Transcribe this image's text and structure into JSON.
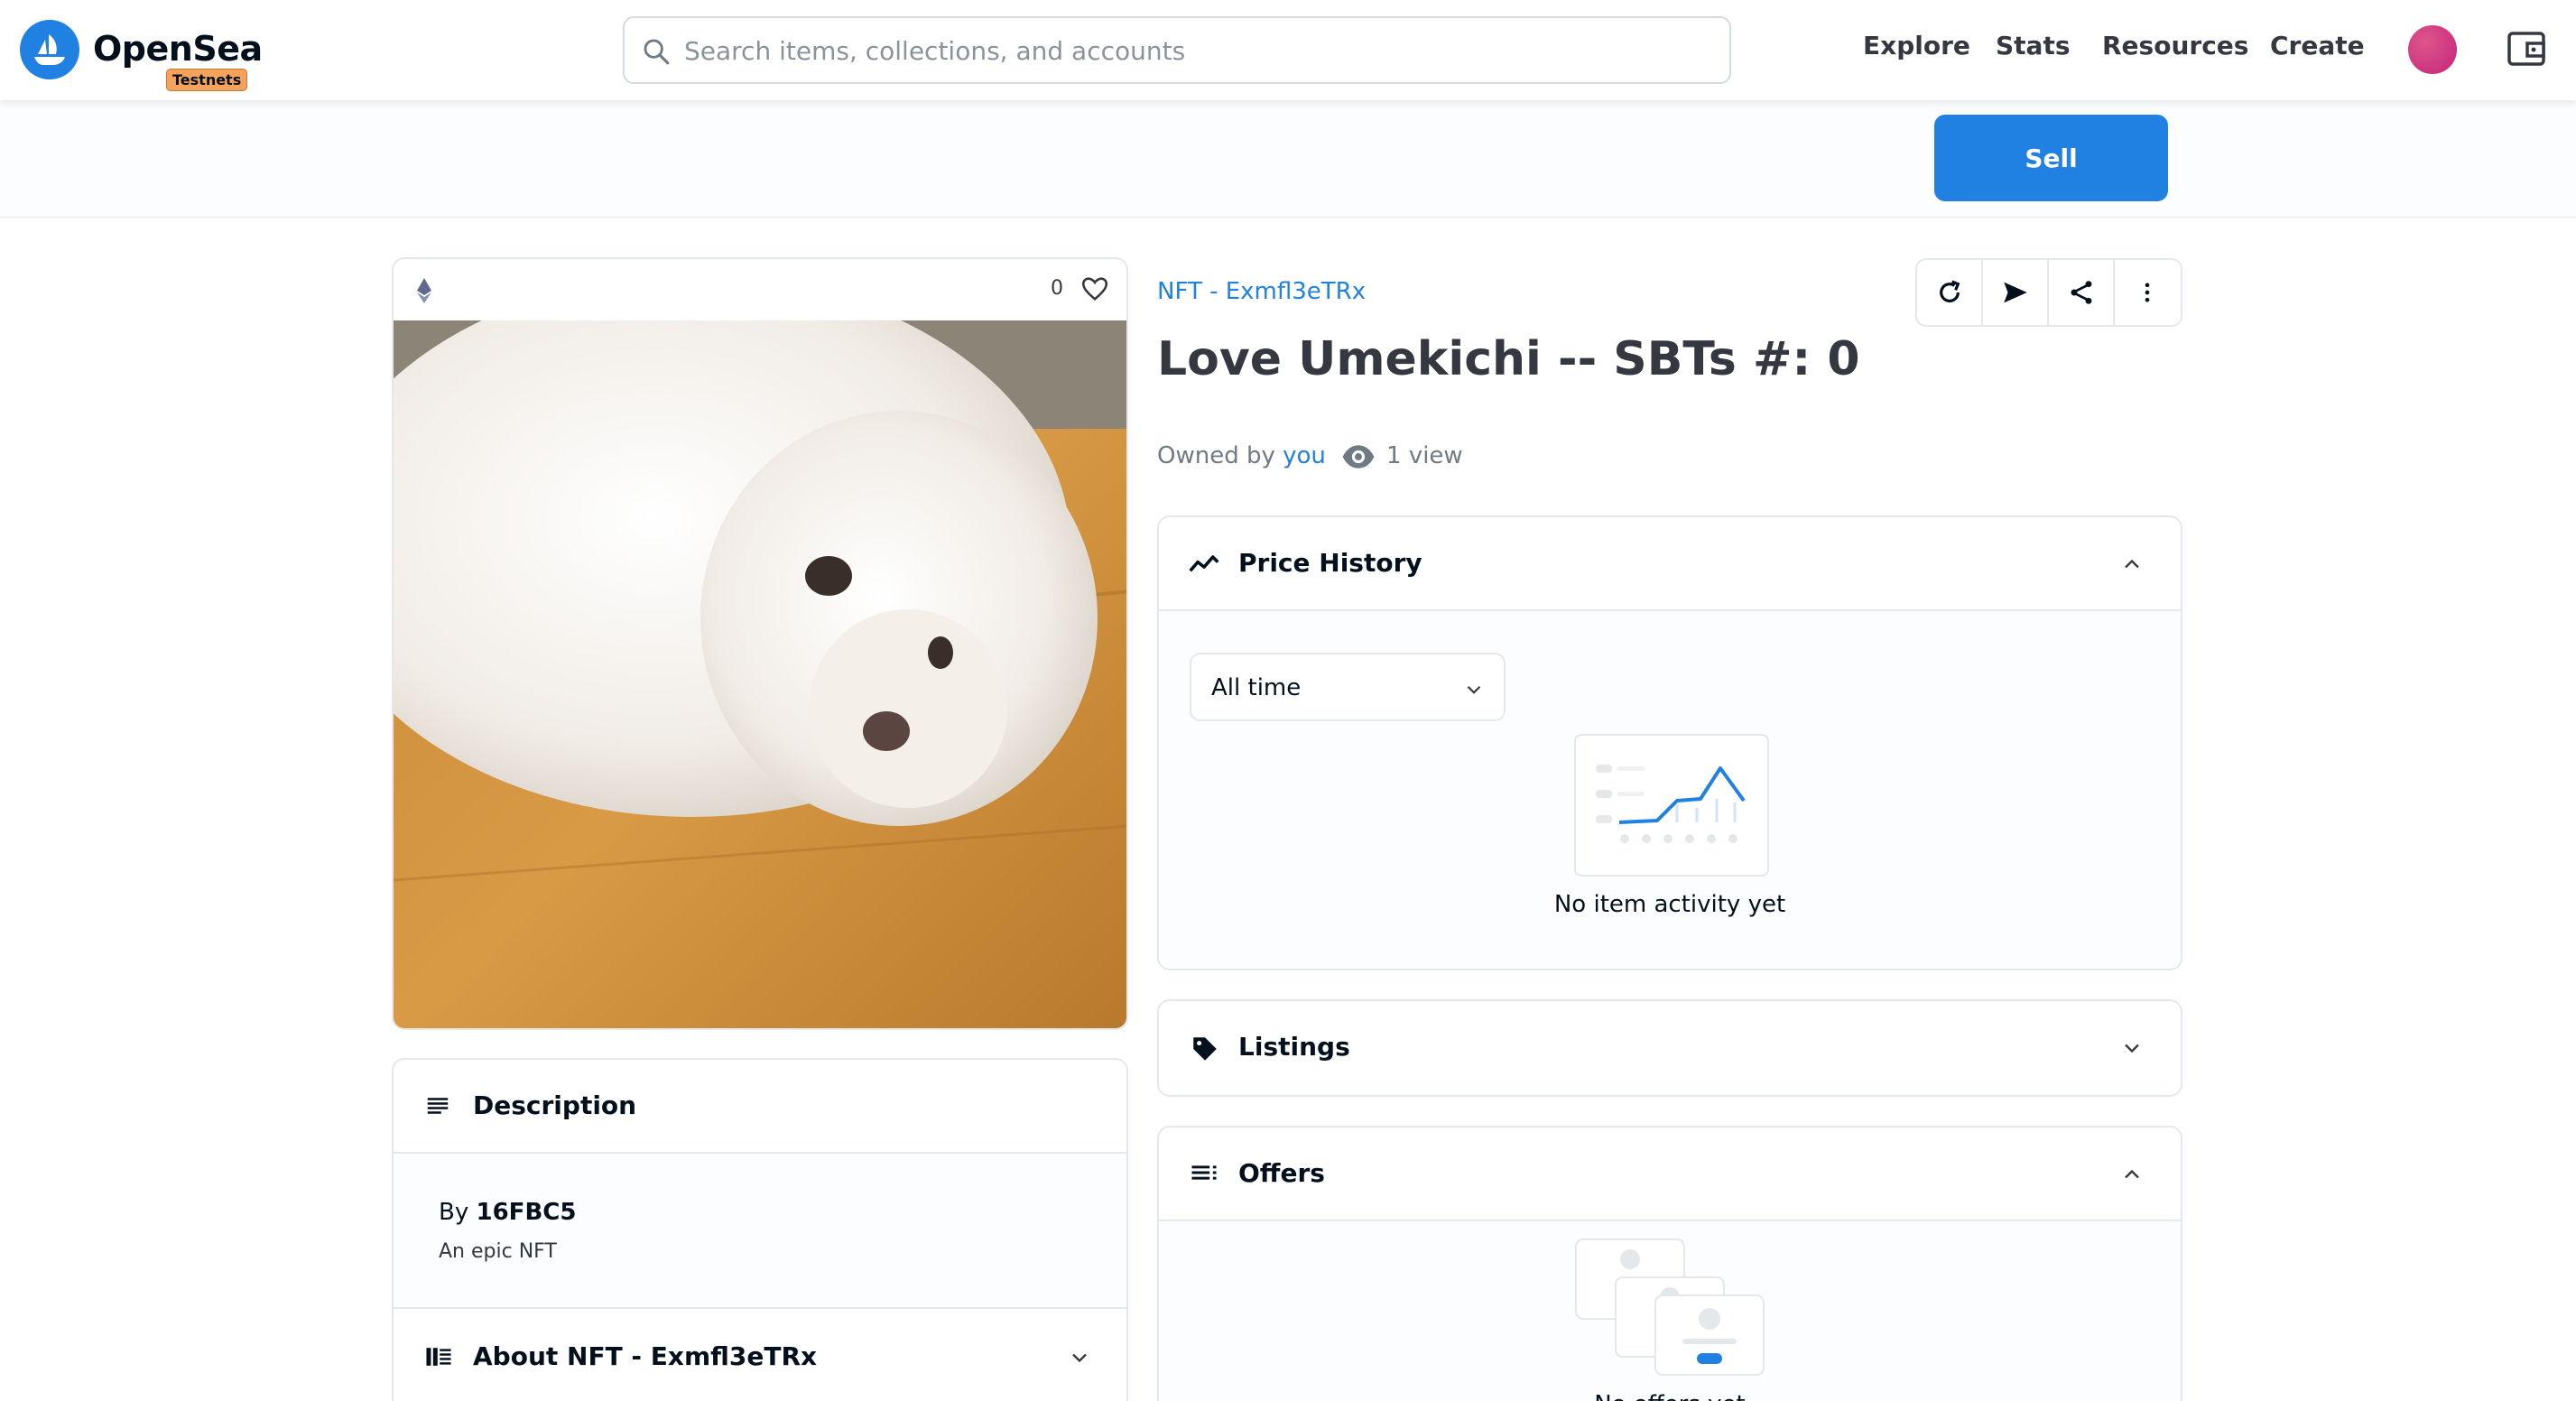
{
  "nav": {
    "brand": "OpenSea",
    "badge": "Testnets",
    "search_placeholder": "Search items, collections, and accounts",
    "links": [
      "Explore",
      "Stats",
      "Resources",
      "Create"
    ]
  },
  "sell": {
    "label": "Sell"
  },
  "item": {
    "favorites": "0",
    "collection": "NFT - Exmfl3eTRx",
    "title": "Love Umekichi -- SBTs #: 0",
    "owned_prefix": "Owned by",
    "owner": "you",
    "views": "1 view"
  },
  "description": {
    "title": "Description",
    "by_prefix": "By",
    "creator": "16FBC5",
    "text": "An epic NFT",
    "about_title": "About NFT - Exmfl3eTRx"
  },
  "price_history": {
    "title": "Price History",
    "range": "All time",
    "empty": "No item activity yet"
  },
  "listings": {
    "title": "Listings"
  },
  "offers": {
    "title": "Offers",
    "empty": "No offers yet"
  },
  "colors": {
    "accent": "#2081e2",
    "border": "#e5e8eb"
  }
}
